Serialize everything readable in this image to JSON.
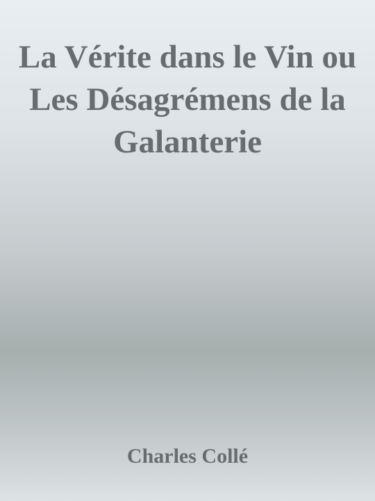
{
  "book": {
    "title": "La Vérite dans le Vin ou Les Désagrémens de la Galanterie",
    "author": "Charles Collé"
  },
  "colors": {
    "text": "#666d6e",
    "background_top": "#e9eef2",
    "background_mid": "#a6aeae",
    "background_bottom": "#dde2e4"
  }
}
